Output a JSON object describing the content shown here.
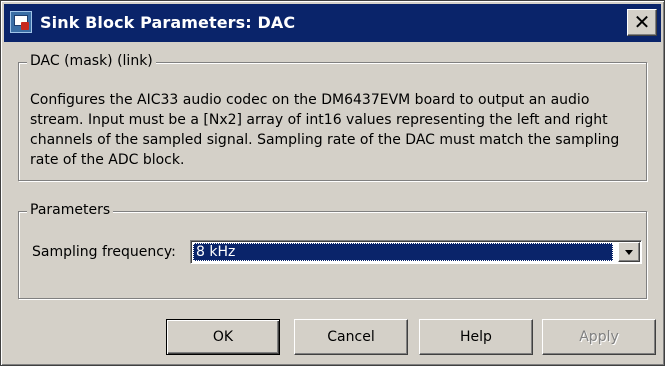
{
  "window": {
    "title": "Sink Block Parameters: DAC",
    "close_glyph": "✕",
    "icon": "simulink-block-icon",
    "colors": {
      "title_bar": "#0a246a",
      "title_text": "#ffffff",
      "face": "#d4d0c8",
      "selection": "#0a246a"
    }
  },
  "description": {
    "group_label": "DAC (mask) (link)",
    "text": "Configures the AIC33 audio codec on the DM6437EVM board to output an audio stream. Input must be a [Nx2] array of int16 values representing the left and right channels of the sampled signal. Sampling rate of the DAC must match the sampling rate of the ADC block."
  },
  "parameters": {
    "group_label": "Parameters",
    "sampling_frequency": {
      "label": "Sampling frequency:",
      "value": "8 kHz"
    }
  },
  "buttons": {
    "ok": "OK",
    "cancel": "Cancel",
    "help": "Help",
    "apply": "Apply"
  }
}
